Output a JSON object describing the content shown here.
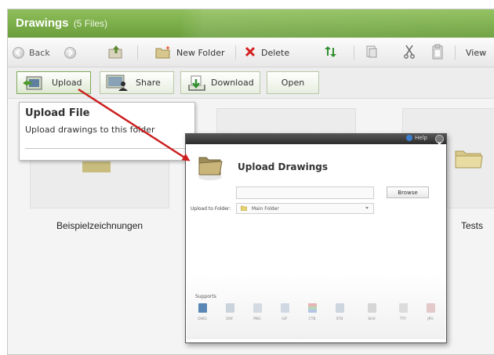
{
  "window": {
    "title": "Drawings",
    "file_count": "(5 Files)"
  },
  "toolbar": {
    "back_label": "Back",
    "new_folder_label": "New Folder",
    "delete_label": "Delete",
    "view_label": "View"
  },
  "actions": {
    "upload_label": "Upload",
    "share_label": "Share",
    "download_label": "Download",
    "open_label": "Open"
  },
  "content": {
    "items": [
      {
        "label": "Beispielzeichnungen"
      },
      {
        "label": "Tests"
      }
    ]
  },
  "tooltip": {
    "title": "Upload File",
    "text": "Upload drawings to this folder"
  },
  "dialog": {
    "help_label": "Help",
    "title": "Upload Drawings",
    "browse_label": "Browse",
    "upload_to_label": "Upload to Folder:",
    "folder_value": "Main Folder",
    "supports_label": "Supports",
    "formats": [
      "DWG",
      "DXF",
      "PNG",
      "GIF",
      "CTB",
      "STB",
      "SHX",
      "TTF",
      "JPG"
    ]
  },
  "colors": {
    "title_bar": "#7aad47",
    "arrow": "#cc1f1f",
    "delete_icon": "#d42020"
  },
  "icons": {
    "back": "back-arrow-icon",
    "forward": "forward-arrow-icon",
    "up": "up-folder-icon",
    "new_folder": "new-folder-icon",
    "delete": "delete-x-icon",
    "move": "move-arrows-icon",
    "copy": "copy-icon",
    "cut": "cut-scissors-icon",
    "paste": "paste-icon",
    "upload": "upload-icon",
    "share": "share-icon",
    "download": "download-icon",
    "help": "help-icon",
    "close": "close-icon",
    "folder": "folder-icon"
  }
}
